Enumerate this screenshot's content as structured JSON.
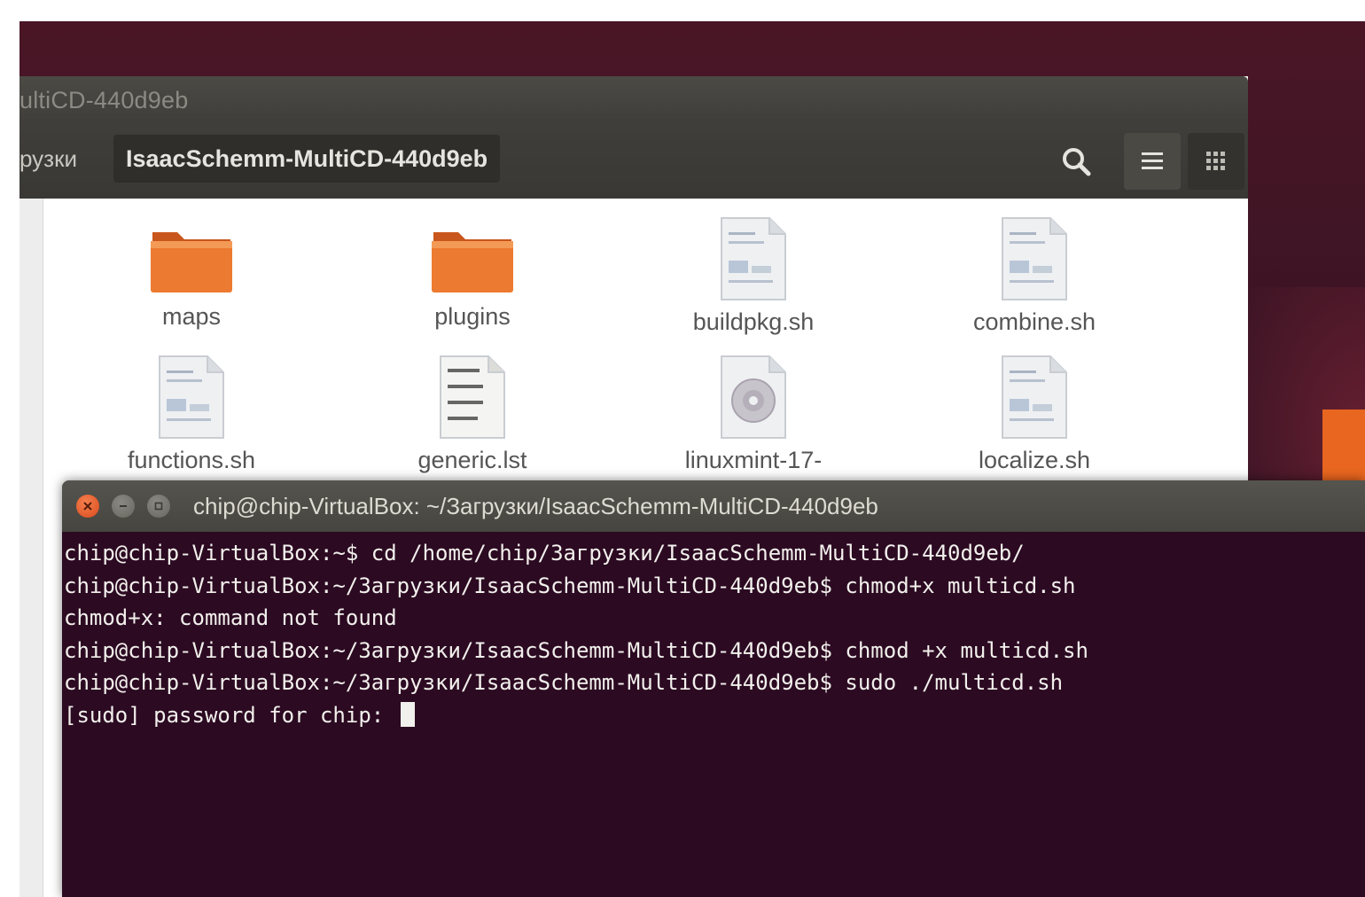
{
  "desktop": {
    "accent_color": "#e8661f"
  },
  "file_manager": {
    "window_title": "ultiCD-440d9eb",
    "breadcrumb_prev": "рузки",
    "breadcrumb_current": "IsaacSchemm-MultiCD-440d9eb",
    "toolbar_icons": [
      "search-icon",
      "list-view-icon",
      "grid-view-icon"
    ],
    "files": [
      {
        "name": "maps",
        "type": "folder"
      },
      {
        "name": "plugins",
        "type": "folder"
      },
      {
        "name": "buildpkg.sh",
        "type": "script"
      },
      {
        "name": "combine.sh",
        "type": "script"
      },
      {
        "name": "functions.sh",
        "type": "script"
      },
      {
        "name": "generic.lst",
        "type": "text"
      },
      {
        "name": "linuxmint-17-",
        "type": "disc-image"
      },
      {
        "name": "localize.sh",
        "type": "script"
      }
    ]
  },
  "terminal": {
    "title": "chip@chip-VirtualBox: ~/Загрузки/IsaacSchemm-MultiCD-440d9eb",
    "lines": [
      "chip@chip-VirtualBox:~$ cd /home/chip/Загрузки/IsaacSchemm-MultiCD-440d9eb/",
      "chip@chip-VirtualBox:~/Загрузки/IsaacSchemm-MultiCD-440d9eb$ chmod+x multicd.sh",
      "chmod+x: command not found",
      "chip@chip-VirtualBox:~/Загрузки/IsaacSchemm-MultiCD-440d9eb$ chmod +x multicd.sh",
      "chip@chip-VirtualBox:~/Загрузки/IsaacSchemm-MultiCD-440d9eb$ sudo ./multicd.sh",
      "[sudo] password for chip: "
    ]
  }
}
